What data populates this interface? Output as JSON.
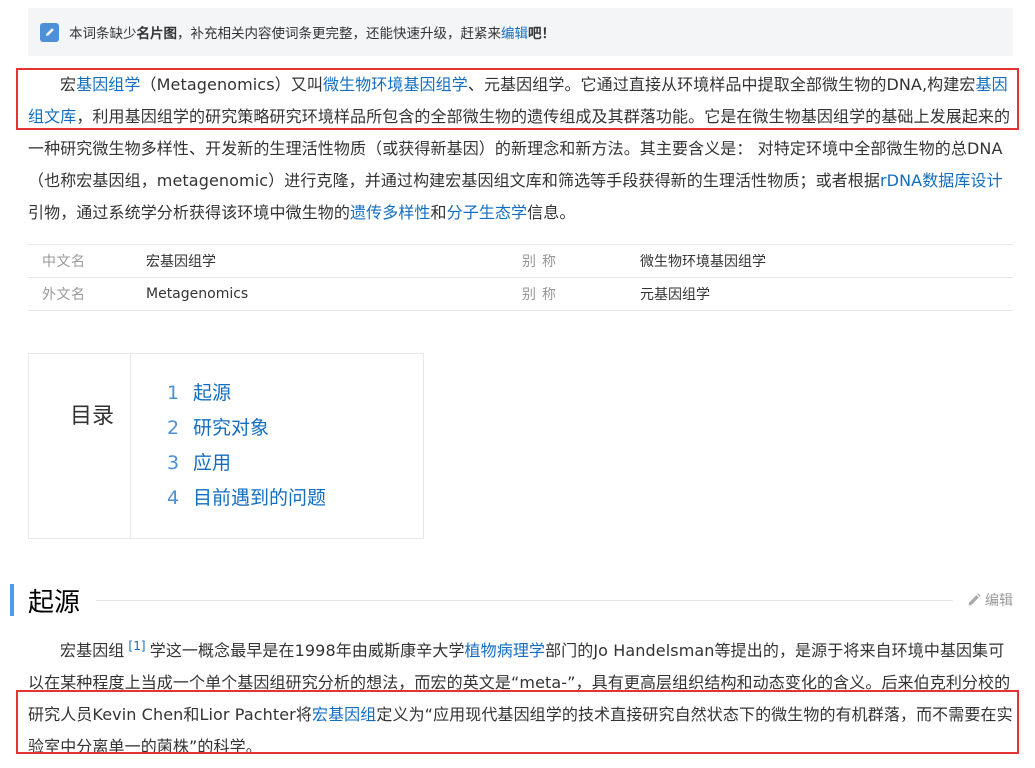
{
  "notice": {
    "pre": "本词条缺少",
    "bold": "名片图",
    "mid": "，补充相关内容使词条更完整，还能快速升级，赶紧来",
    "link": "编辑",
    "post": "吧！"
  },
  "intro": {
    "s1": "宏",
    "l1": "基因组学",
    "s2": "（Metagenomics）又叫",
    "l2": "微生物环境基因组学",
    "s3": "、元基因组学。它通过直接从环境样品中提取全部微生物的DNA,构建宏",
    "l3": "基因组文库",
    "s4": "，利用基因组学的研究策略研究环境样品所包含的全部微生物的遗传组成及其群落功能。它是在微生物基因组学的基础上发展起来的一种研究微生物多样性、开发新的生理活性物质（或获得新基因）的新理念和新方法。其主要含义是： 对特定环境中全部微生物的总DNA（也称宏基因组，metagenomic）进行克隆，并通过构建宏基因组文库和筛选等手段获得新的生理活性物质；或者根据",
    "l4": "rDNA",
    "l5": "数据库设计",
    "s5": "引物，通过系统学分析获得该环境中微生物的",
    "l6": "遗传多样性",
    "s6": "和",
    "l7": "分子生态学",
    "s7": "信息。"
  },
  "basic_info": [
    {
      "key": "中文名",
      "value": "宏基因组学",
      "key2": "别称",
      "value2": "微生物环境基因组学"
    },
    {
      "key": "外文名",
      "value": "Metagenomics",
      "key2": "别称",
      "value2": "元基因组学"
    }
  ],
  "catalog": {
    "title": "目录",
    "items": [
      {
        "num": "1",
        "label": "起源"
      },
      {
        "num": "2",
        "label": "研究对象"
      },
      {
        "num": "3",
        "label": "应用"
      },
      {
        "num": "4",
        "label": "目前遇到的问题"
      }
    ]
  },
  "section": {
    "title": "起源",
    "edit": "编辑"
  },
  "origin": {
    "s1": "宏基因组",
    "ref": "[1]",
    "s2": "学这一概念最早是在1998年由威斯康辛大学",
    "l1": "植物病理学",
    "s3": "部门的Jo Handelsman等提出的，是源于将来自环境中基因集可以在某种程度上当成一个单个基因组研究分析的想法，而宏的英文是“meta-”，具有更高层组织结构和动态变化的含义。后来伯克利分校的研究人员Kevin Chen和Lior Pachter将",
    "l2": "宏基因组",
    "s4": "定义为“应用现代基因组学的技术直接研究自然状态下的微生物的有机群落，而不需要在实验室中分离单一的菌株”的科学。"
  },
  "colors": {
    "link": "#136ec2",
    "highlight_border": "#e53333",
    "section_bar": "#4f9cee"
  }
}
